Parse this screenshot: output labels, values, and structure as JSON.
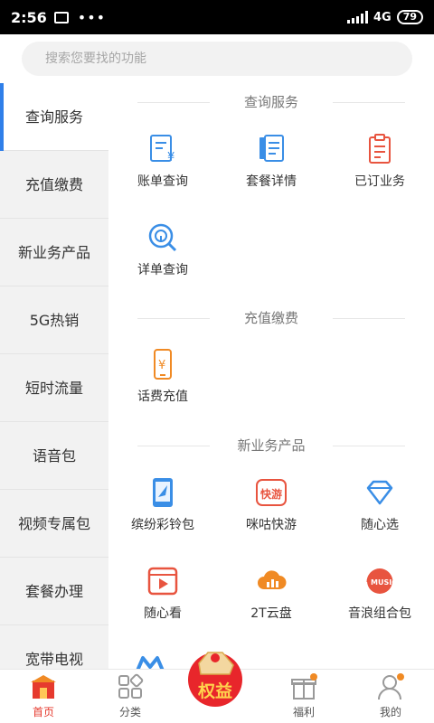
{
  "status_bar": {
    "time": "2:56",
    "network": "4G",
    "battery": "79"
  },
  "search": {
    "placeholder": "搜索您要找的功能"
  },
  "sidebar": {
    "items": [
      {
        "label": "查询服务",
        "active": true
      },
      {
        "label": "充值缴费"
      },
      {
        "label": "新业务产品"
      },
      {
        "label": "5G热销"
      },
      {
        "label": "短时流量"
      },
      {
        "label": "语音包"
      },
      {
        "label": "视频专属包"
      },
      {
        "label": "套餐办理"
      },
      {
        "label": "宽带电视"
      }
    ]
  },
  "sections": [
    {
      "title": "查询服务",
      "items": [
        {
          "label": "账单查询",
          "icon": "bill-icon"
        },
        {
          "label": "套餐详情",
          "icon": "package-detail-icon"
        },
        {
          "label": "已订业务",
          "icon": "clipboard-icon"
        },
        {
          "label": "详单查询",
          "icon": "detail-search-icon"
        }
      ]
    },
    {
      "title": "充值缴费",
      "items": [
        {
          "label": "话费充值",
          "icon": "phone-recharge-icon"
        }
      ]
    },
    {
      "title": "新业务产品",
      "items": [
        {
          "label": "缤纷彩铃包",
          "icon": "ringtone-icon"
        },
        {
          "label": "咪咕快游",
          "icon": "migu-game-icon"
        },
        {
          "label": "随心选",
          "icon": "diamond-icon"
        },
        {
          "label": "随心看",
          "icon": "video-icon"
        },
        {
          "label": "2T云盘",
          "icon": "cloud-disk-icon"
        },
        {
          "label": "音浪组合包",
          "icon": "music-icon"
        }
      ]
    }
  ],
  "badge": {
    "text": "权益"
  },
  "tabbar": {
    "items": [
      {
        "label": "首页",
        "active": true
      },
      {
        "label": "分类"
      },
      {
        "label": "福利"
      },
      {
        "label": "我的"
      }
    ]
  },
  "colors": {
    "accent": "#2f7fe9",
    "blue_icon": "#3a8ee6",
    "orange_icon": "#f08a24",
    "red_icon": "#e8543f",
    "active_tab": "#e63a2e"
  }
}
